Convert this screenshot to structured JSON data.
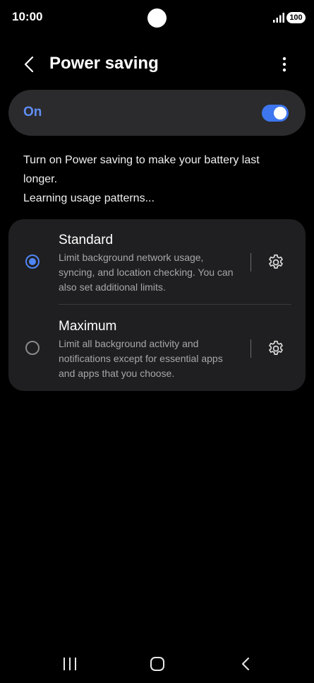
{
  "status_bar": {
    "time": "10:00",
    "battery": "100"
  },
  "header": {
    "title": "Power saving",
    "back_icon": "chevron-left-icon",
    "more_icon": "more-vertical-icon"
  },
  "master_switch": {
    "label": "On",
    "enabled": true
  },
  "description": {
    "line1": "Turn on Power saving to make your battery last longer.",
    "line2": "Learning usage patterns..."
  },
  "options": [
    {
      "title": "Standard",
      "description": "Limit background network usage, syncing, and location checking. You can also set additional limits.",
      "selected": true
    },
    {
      "title": "Maximum",
      "description": "Limit all background activity and notifications except for essential apps and apps that you choose.",
      "selected": false
    }
  ],
  "colors": {
    "accent": "#3d76ee",
    "accent_text": "#5f8df2",
    "background": "#000000",
    "card": "#1f1f21",
    "switch_bar": "#2b2b2d"
  }
}
